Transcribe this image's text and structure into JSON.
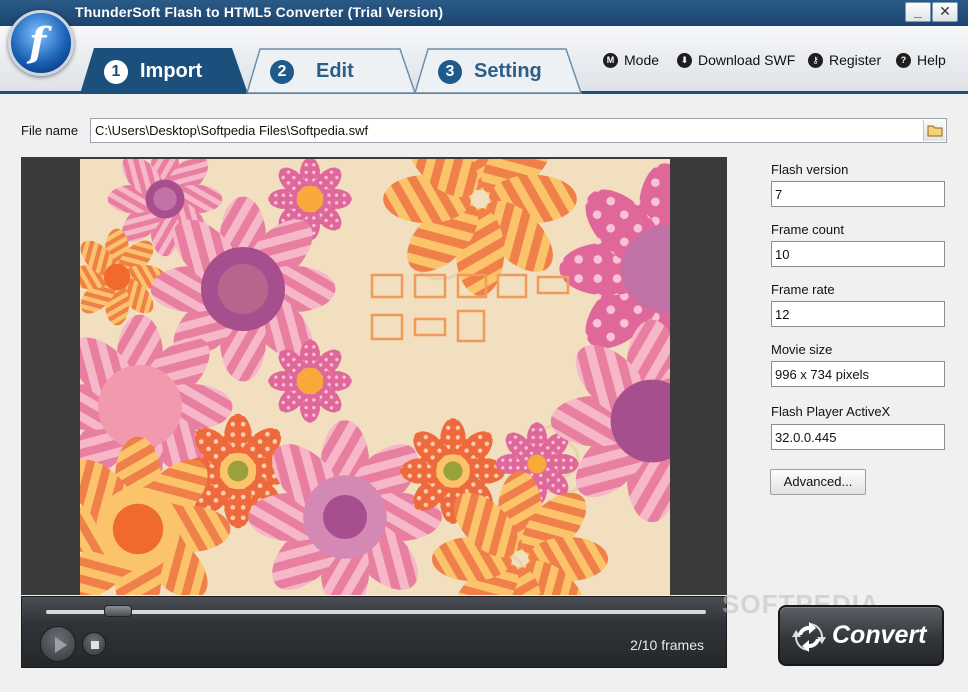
{
  "window": {
    "title": "ThunderSoft Flash to HTML5 Converter (Trial Version)",
    "minimize": "_",
    "close": "✕"
  },
  "tabs": [
    {
      "num": "1",
      "label": "Import"
    },
    {
      "num": "2",
      "label": "Edit"
    },
    {
      "num": "3",
      "label": "Setting"
    }
  ],
  "menu": [
    {
      "icon": "M",
      "label": "Mode"
    },
    {
      "icon": "⬇",
      "label": "Download SWF"
    },
    {
      "icon": "🔑",
      "label": "Register"
    },
    {
      "icon": "?",
      "label": "Help"
    }
  ],
  "file": {
    "label": "File name",
    "value": "C:\\Users\\Desktop\\Softpedia Files\\Softpedia.swf"
  },
  "info": [
    {
      "label": "Flash version",
      "value": "7"
    },
    {
      "label": "Frame count",
      "value": "10"
    },
    {
      "label": "Frame rate",
      "value": "12"
    },
    {
      "label": "Movie size",
      "value": "996 x 734 pixels"
    },
    {
      "label": "Flash Player ActiveX",
      "value": "32.0.0.445"
    }
  ],
  "advanced_label": "Advanced...",
  "player": {
    "frames": "2/10 frames",
    "progress": 0.2
  },
  "convert_label": "Convert",
  "watermark": "SOFTPEDIA",
  "colors": {
    "accent": "#1b4f7c",
    "stage_bg": "#f1dfbf"
  }
}
